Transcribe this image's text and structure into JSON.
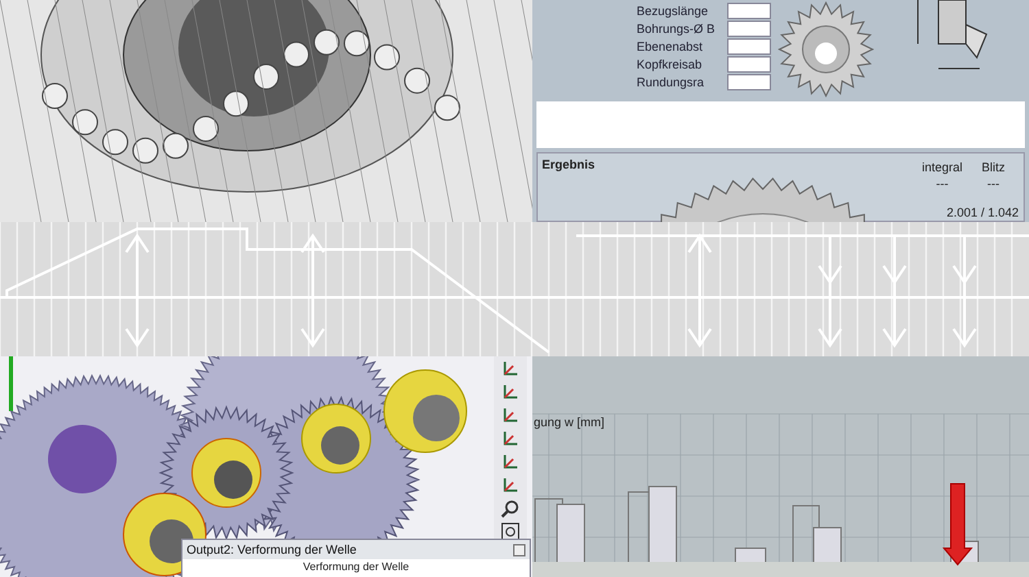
{
  "top_right_panel": {
    "input_labels": [
      "Bezugslänge",
      "Bohrungs-Ø B",
      "Ebenenabst",
      "Kopfkreisab",
      "Rundungsra"
    ],
    "results": {
      "title": "Ergebnis",
      "columns": [
        "integral",
        "Blitz"
      ],
      "values": [
        "---",
        "---"
      ],
      "ratio": "2.001 / 1.042"
    }
  },
  "bottom_left_panel": {
    "dialog": {
      "title": "Output2: Verformung der Welle",
      "chart_title": "Verformung der Welle"
    }
  },
  "bottom_right_panel": {
    "axis_label": "gung w [mm]"
  }
}
